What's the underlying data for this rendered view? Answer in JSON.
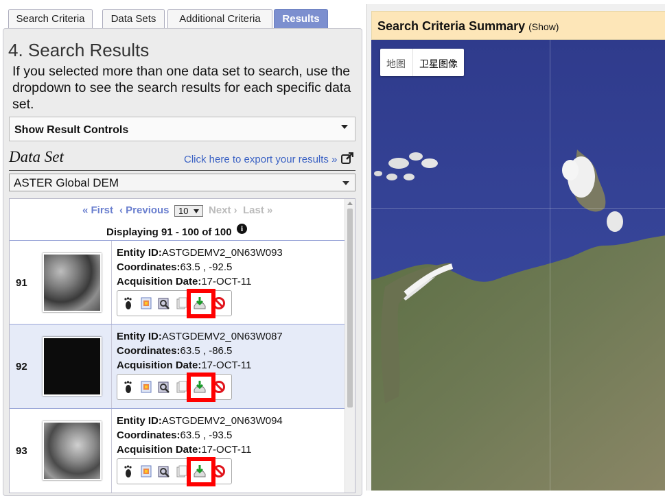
{
  "tabs": [
    "Search Criteria",
    "Data Sets",
    "Additional Criteria",
    "Results"
  ],
  "active_tab": "Results",
  "page_title": "4. Search Results",
  "intro_text": "If you selected more than one data set to search, use the dropdown to see the search results for each specific data set.",
  "result_controls_label": "Show Result Controls",
  "dataset_label": "Data Set",
  "export_link": "Click here to export your results »",
  "dataset_value": "ASTER Global DEM",
  "pager": {
    "first": "« First",
    "previous": "‹ Previous",
    "page_size": "10",
    "next": "Next ›",
    "last": "Last »"
  },
  "displaying": "Displaying 91 - 100 of 100",
  "labels": {
    "entity": "Entity ID:",
    "coords": "Coordinates:",
    "acq": "Acquisition Date:"
  },
  "results": [
    {
      "num": "91",
      "entity_id": "ASTGDEMV2_0N63W093",
      "coordinates": "63.5 , -92.5",
      "date": "17-OCT-11"
    },
    {
      "num": "92",
      "entity_id": "ASTGDEMV2_0N63W087",
      "coordinates": "63.5 , -86.5",
      "date": "17-OCT-11"
    },
    {
      "num": "93",
      "entity_id": "ASTGDEMV2_0N63W094",
      "coordinates": "63.5 , -93.5",
      "date": "17-OCT-11"
    }
  ],
  "summary": {
    "title": "Search Criteria Summary",
    "show": "(Show)"
  },
  "map": {
    "type_map": "地图",
    "type_satellite": "卫星图像"
  }
}
